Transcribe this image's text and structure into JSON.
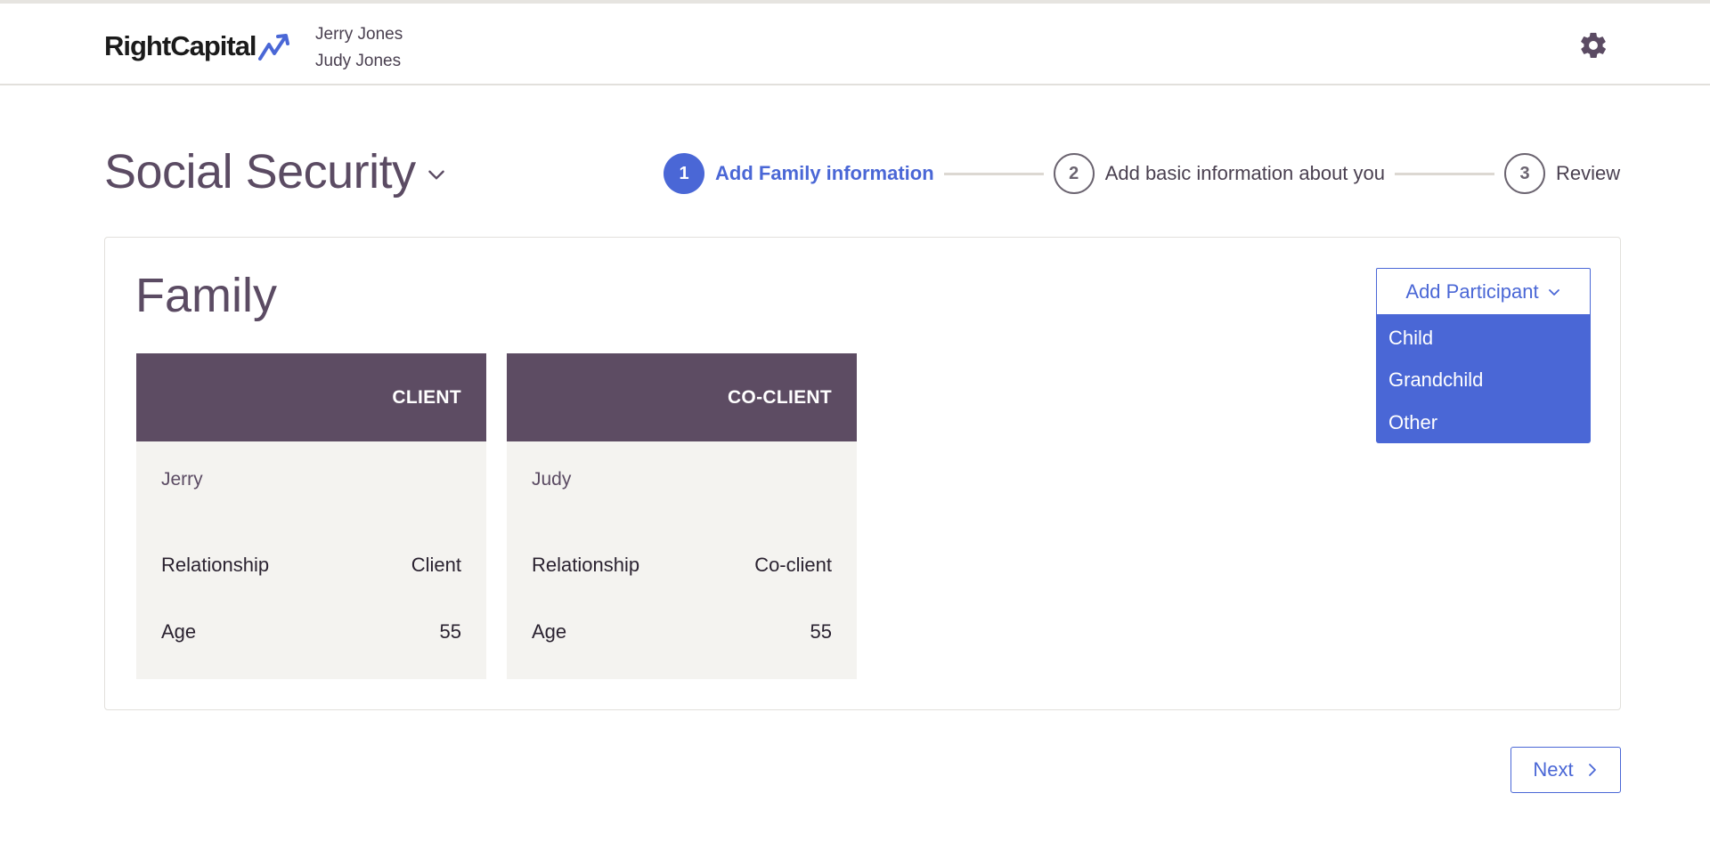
{
  "header": {
    "logo_text": "RightCapital",
    "clients": [
      "Jerry Jones",
      "Judy Jones"
    ],
    "settings_icon": "gear-icon"
  },
  "page": {
    "title": "Social Security",
    "title_dropdown_icon": "chevron-down-icon"
  },
  "stepper": {
    "steps": [
      {
        "number": "1",
        "label": "Add Family information",
        "state": "active"
      },
      {
        "number": "2",
        "label": "Add basic information about you",
        "state": "idle"
      },
      {
        "number": "3",
        "label": "Review",
        "state": "idle"
      }
    ]
  },
  "family": {
    "title": "Family",
    "add_participant_label": "Add Participant",
    "add_participant_options": [
      "Child",
      "Grandchild",
      "Other"
    ],
    "cards": [
      {
        "role": "CLIENT",
        "name": "Jerry",
        "relationship_label": "Relationship",
        "relationship_value": "Client",
        "age_label": "Age",
        "age_value": "55"
      },
      {
        "role": "CO-CLIENT",
        "name": "Judy",
        "relationship_label": "Relationship",
        "relationship_value": "Co-client",
        "age_label": "Age",
        "age_value": "55"
      }
    ]
  },
  "footer": {
    "next_label": "Next"
  },
  "colors": {
    "accent": "#4a67d6",
    "card_header": "#5d4c63",
    "title_text": "#5b4b63",
    "card_bg": "#f4f3f0"
  }
}
